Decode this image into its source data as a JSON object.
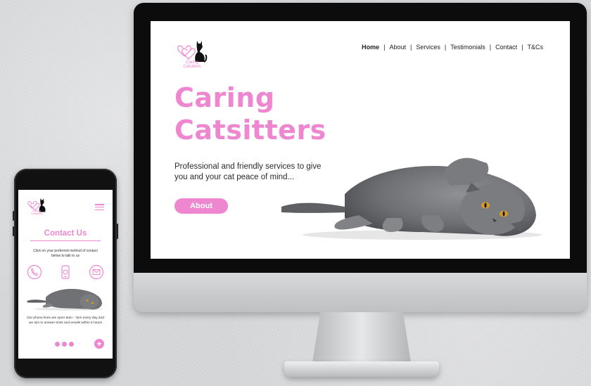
{
  "desktop": {
    "logo_text": "Caring Catsitters",
    "nav": [
      {
        "label": "Home",
        "active": true
      },
      {
        "label": "About"
      },
      {
        "label": "Services"
      },
      {
        "label": "Testimonials"
      },
      {
        "label": "Contact"
      },
      {
        "label": "T&Cs"
      }
    ],
    "nav_separator": "|",
    "hero_title_line1": "Caring",
    "hero_title_line2": "Catsitters",
    "hero_subtitle": "Professional and friendly services to give you and your cat peace of mind...",
    "cta_label": "About"
  },
  "mobile": {
    "logo_text": "Caring Catsitters",
    "title": "Contact Us",
    "intro": "Click on your preferred method of contact below to talk to us",
    "contact_icons": [
      "phone-icon",
      "mobile-message-icon",
      "email-icon"
    ],
    "hours": "Our phone lines are open 8am - 7pm every day and we aim to answer texts and emails within 5 hours",
    "plus_label": "+"
  },
  "colors": {
    "accent_pink": "#ee86d0",
    "text_dark": "#222222",
    "background": "#d6d7d9"
  }
}
